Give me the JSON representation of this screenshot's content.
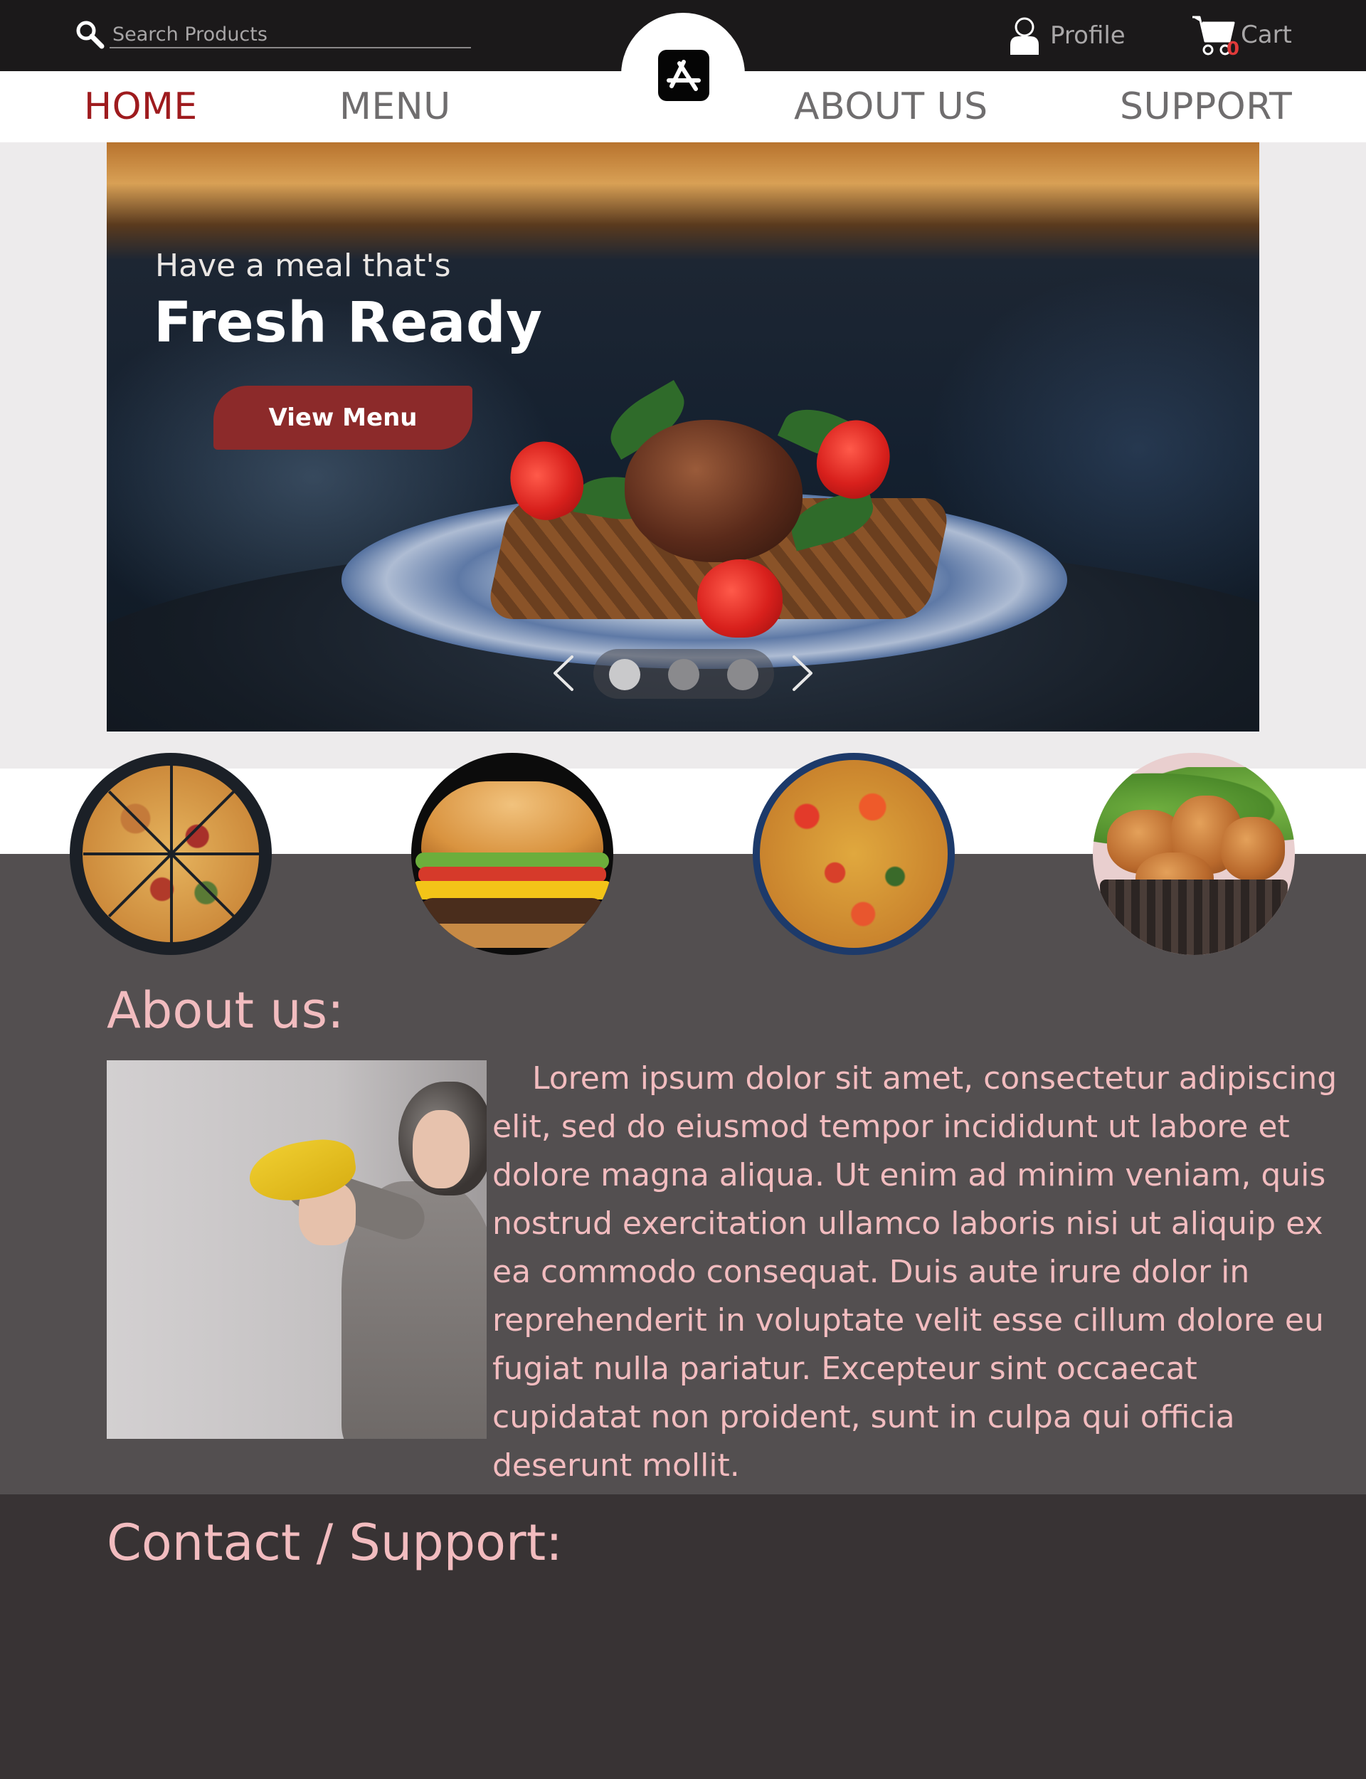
{
  "header": {
    "search": {
      "placeholder": "Search Products",
      "value": ""
    },
    "profile_label": "Profile",
    "cart_label": "Cart",
    "cart_count": "0",
    "logo_icon": "app-store-icon"
  },
  "nav": {
    "items": [
      {
        "label": "HOME",
        "active": true
      },
      {
        "label": "MENU",
        "active": false
      },
      {
        "label": "ABOUT US",
        "active": false
      },
      {
        "label": "SUPPORT",
        "active": false
      }
    ]
  },
  "hero": {
    "tagline": "Have a meal that's",
    "headline": "Fresh Ready",
    "cta_label": "View Menu",
    "slides_total": 3,
    "active_slide": 1
  },
  "categories": [
    {
      "name": "pizza"
    },
    {
      "name": "burger"
    },
    {
      "name": "paella"
    },
    {
      "name": "fried-chicken"
    }
  ],
  "about": {
    "title": "About us:",
    "body": "Lorem ipsum dolor sit amet, consectetur adipiscing elit, sed do eiusmod tempor incididunt ut labore et dolore magna aliqua. Ut enim ad minim veniam, quis nostrud exercitation ullamco laboris nisi ut aliquip ex ea commodo consequat. Duis aute irure dolor in reprehenderit in voluptate velit esse cillum dolore eu fugiat nulla pariatur. Excepteur sint occaecat cupidatat non proident, sunt in culpa qui officia deserunt mollit."
  },
  "contact": {
    "title": "Contact / Support:"
  },
  "colors": {
    "topbar": "#1b191a",
    "nav_active": "#9e1b1e",
    "cta": "#8c2a2a",
    "section_dark": "#534f50",
    "footer_dark": "#383334",
    "accent_text": "#f2bcbf"
  }
}
